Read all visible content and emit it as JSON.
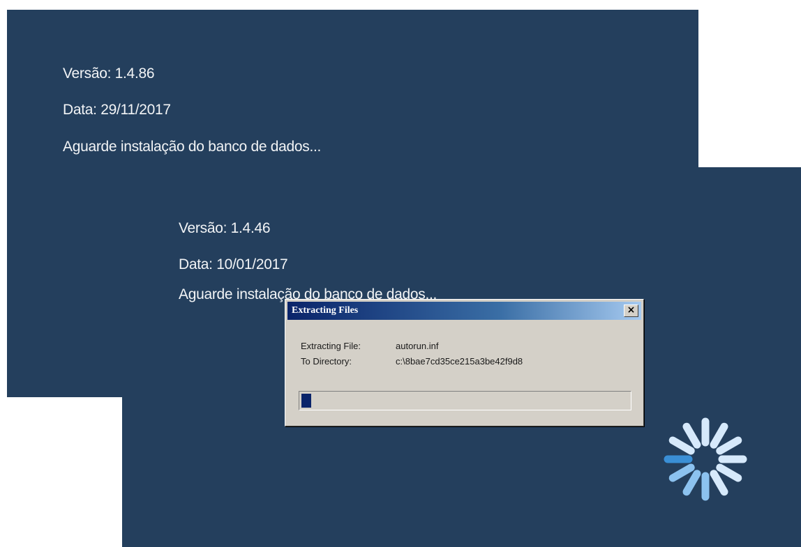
{
  "splash_back": {
    "version": "Versão: 1.4.86",
    "date": "Data: 29/11/2017",
    "status": "Aguarde instalação do banco de dados..."
  },
  "splash_front": {
    "version": "Versão: 1.4.46",
    "date": "Data: 10/01/2017",
    "status": "Aguarde instalação do banco de dados..."
  },
  "dialog": {
    "title": "Extracting Files",
    "close_glyph": "×",
    "extracting_file_label": "Extracting File:",
    "extracting_file_value": "autorun.inf",
    "to_directory_label": "To Directory:",
    "to_directory_value": "c:\\8bae7cd35ce215a3be42f9d8",
    "progress_fraction": 0.03
  },
  "spinner": {
    "icon": "loading-spinner-icon",
    "colors": {
      "active": "#3a8fd6",
      "light": "#d6e9fb",
      "mid": "#8cc2ef"
    }
  },
  "colors": {
    "splash_background": "#243f5d",
    "dialog_face": "#d4d0c8",
    "progress_fill": "#0a246a"
  }
}
